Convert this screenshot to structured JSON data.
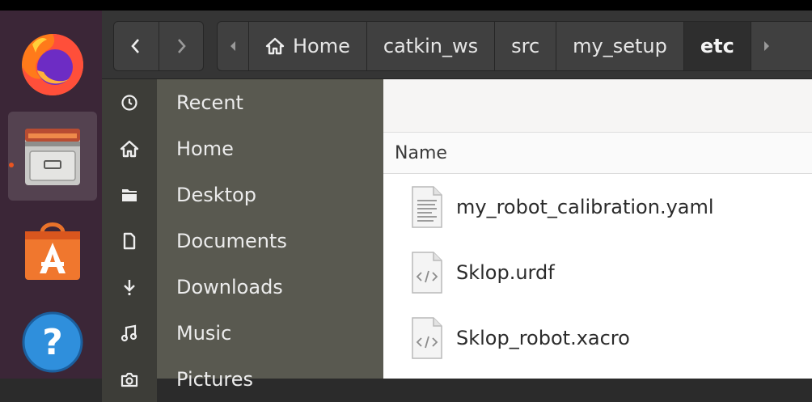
{
  "dock": {
    "apps": [
      {
        "name": "Firefox",
        "icon": "firefox-icon"
      },
      {
        "name": "Files",
        "icon": "file-cabinet-icon",
        "active": true
      },
      {
        "name": "Software",
        "icon": "shopping-bag-icon"
      },
      {
        "name": "Help",
        "icon": "help-icon"
      }
    ]
  },
  "path": {
    "crumbs": [
      "Home",
      "catkin_ws",
      "src",
      "my_setup",
      "etc"
    ],
    "current": "etc"
  },
  "sidebar": {
    "items": [
      {
        "label": "Recent",
        "icon": "clock-icon"
      },
      {
        "label": "Home",
        "icon": "home-icon"
      },
      {
        "label": "Desktop",
        "icon": "folder-icon"
      },
      {
        "label": "Documents",
        "icon": "document-icon"
      },
      {
        "label": "Downloads",
        "icon": "download-icon"
      },
      {
        "label": "Music",
        "icon": "music-icon"
      },
      {
        "label": "Pictures",
        "icon": "camera-icon"
      }
    ]
  },
  "main": {
    "column_header": "Name",
    "files": [
      {
        "name": "my_robot_calibration.yaml",
        "type": "text"
      },
      {
        "name": "Sklop.urdf",
        "type": "code"
      },
      {
        "name": "Sklop_robot.xacro",
        "type": "code"
      }
    ]
  },
  "colors": {
    "dock_bg": "#3b2637",
    "accent": "#e95420",
    "sidebar_bg": "#595950",
    "header_bg": "#353535"
  }
}
